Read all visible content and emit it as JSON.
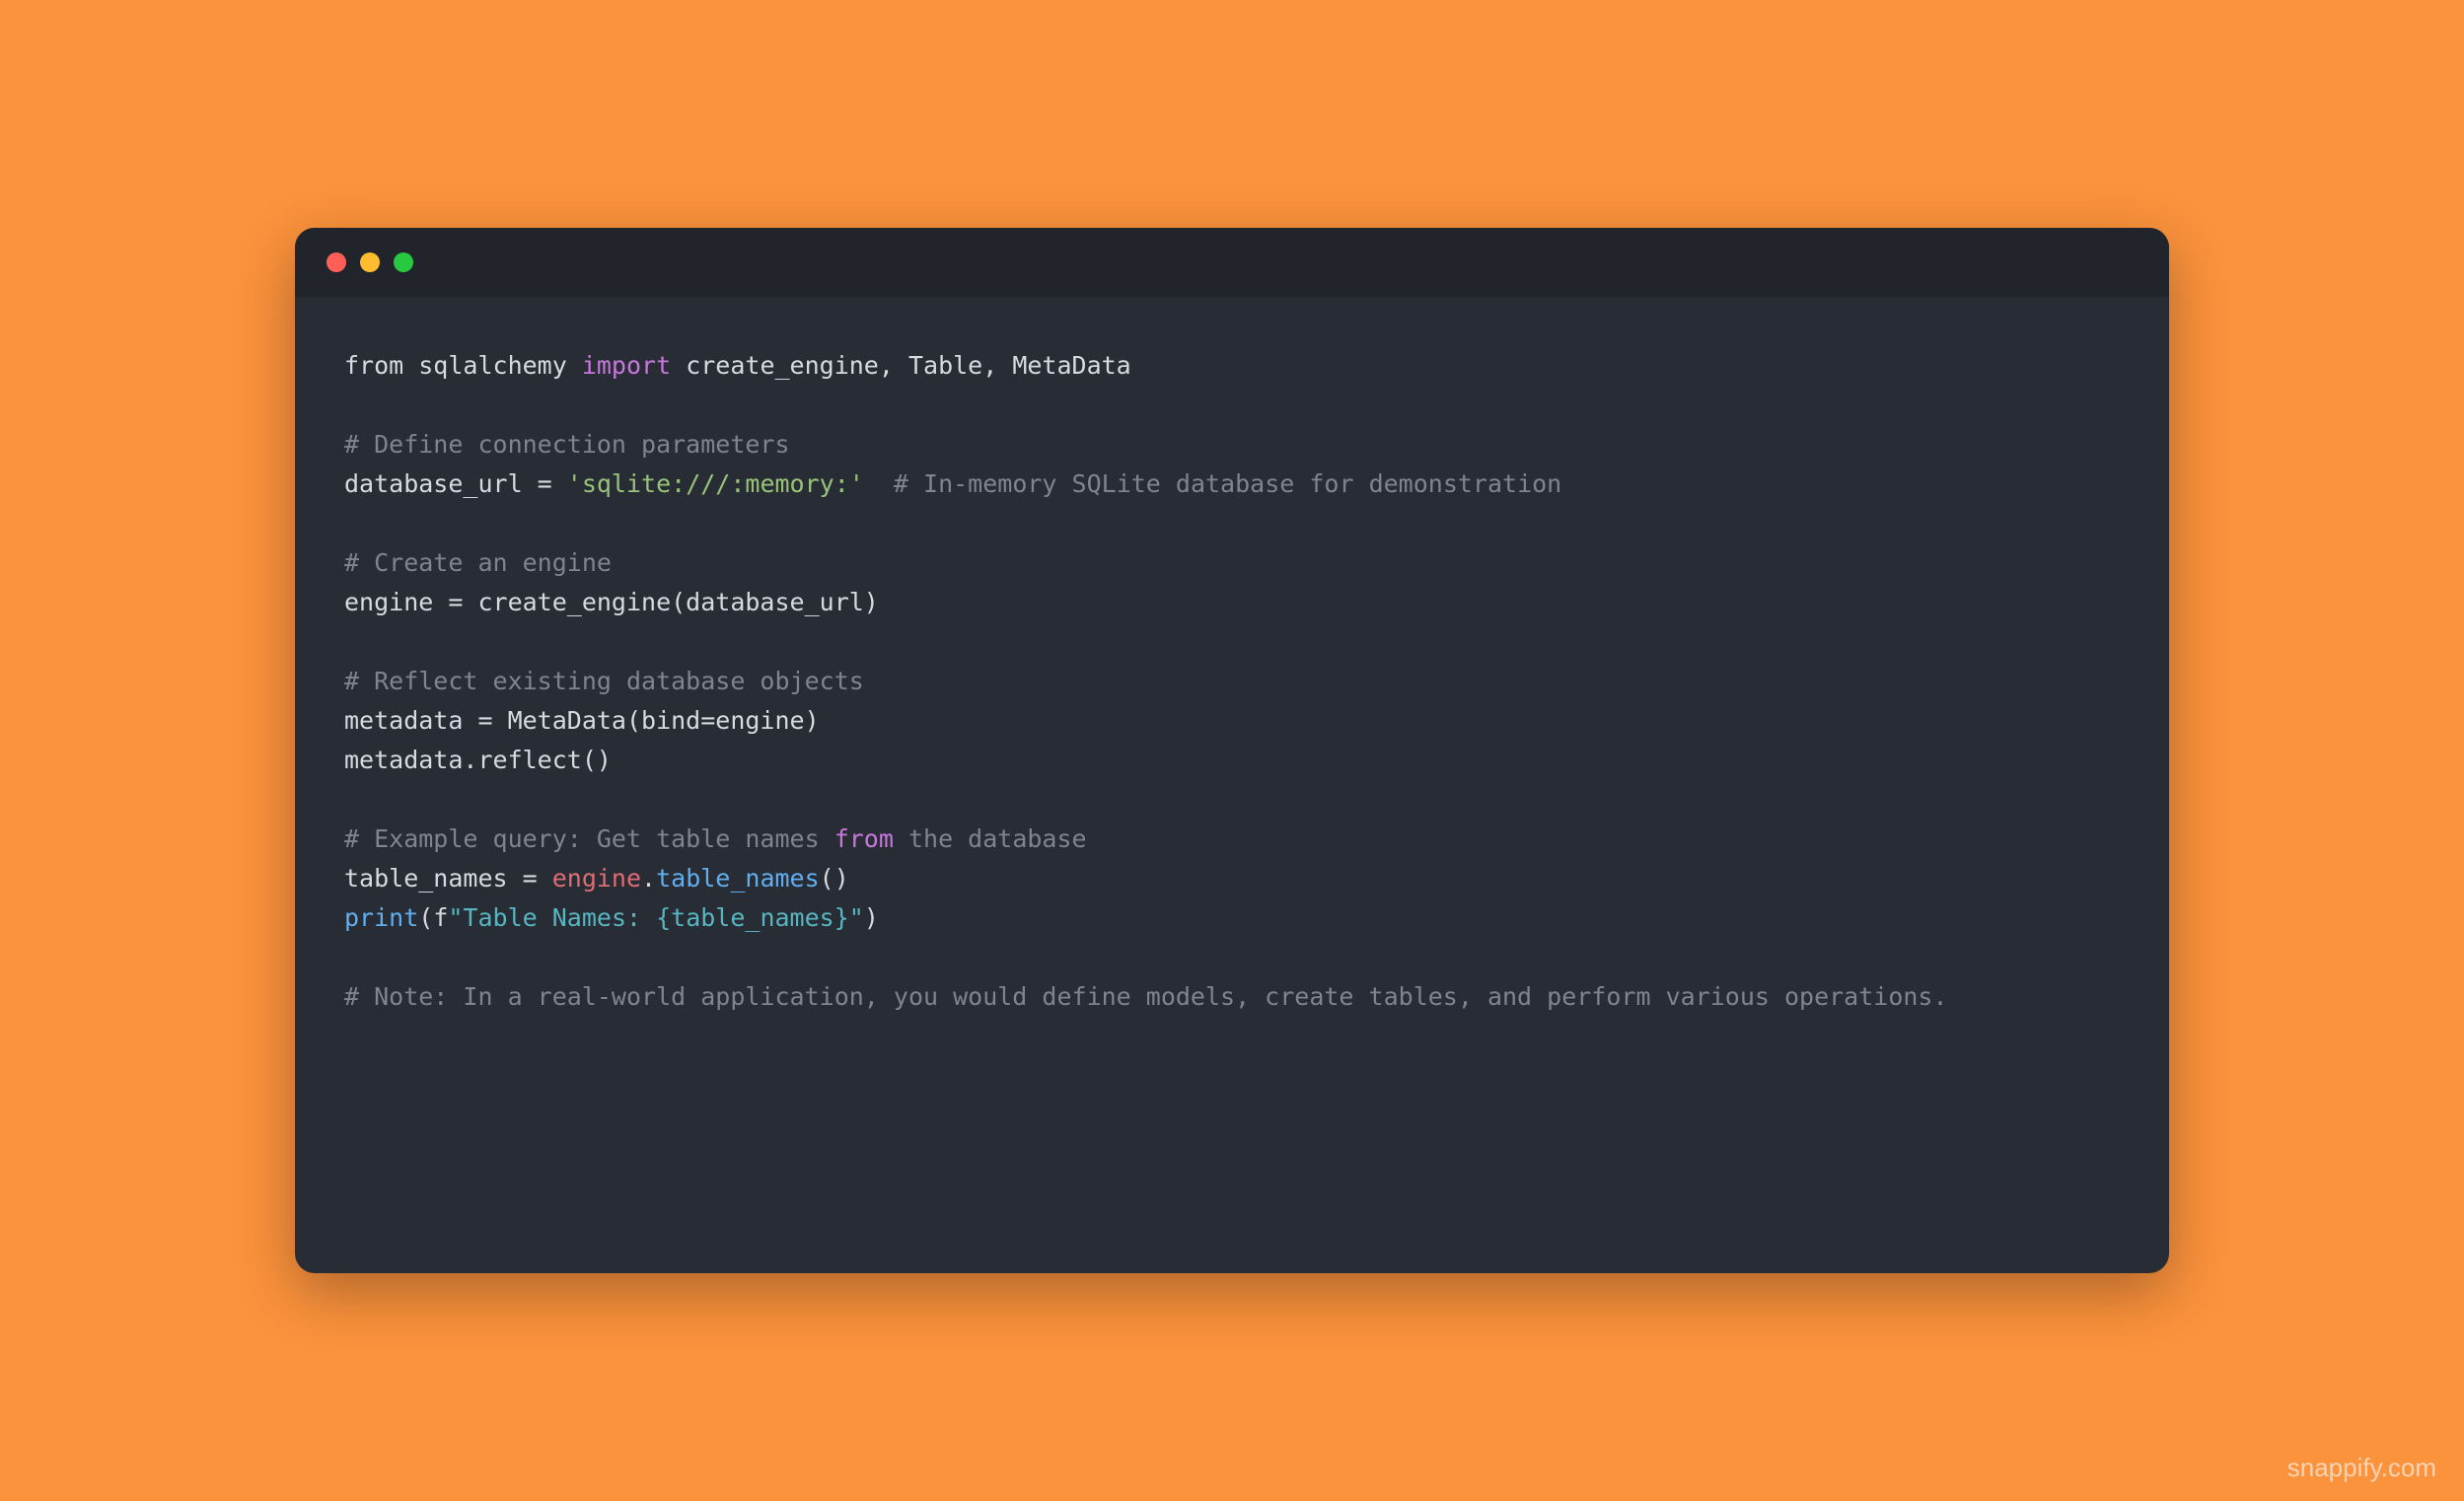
{
  "watermark": "snappify.com",
  "code": {
    "lines": [
      [
        {
          "cls": "tok-default",
          "text": "from sqlalchemy "
        },
        {
          "cls": "tok-keyword",
          "text": "import"
        },
        {
          "cls": "tok-default",
          "text": " create_engine, Table, MetaData"
        }
      ],
      [],
      [
        {
          "cls": "tok-comment",
          "text": "# Define connection parameters"
        }
      ],
      [
        {
          "cls": "tok-default",
          "text": "database_url = "
        },
        {
          "cls": "tok-string",
          "text": "'sqlite:///:memory:'"
        },
        {
          "cls": "tok-default",
          "text": "  "
        },
        {
          "cls": "tok-comment",
          "text": "# In-memory SQLite database for demonstration"
        }
      ],
      [],
      [
        {
          "cls": "tok-comment",
          "text": "# Create an engine"
        }
      ],
      [
        {
          "cls": "tok-default",
          "text": "engine = create_engine(database_url)"
        }
      ],
      [],
      [
        {
          "cls": "tok-comment",
          "text": "# Reflect existing database objects"
        }
      ],
      [
        {
          "cls": "tok-default",
          "text": "metadata = MetaData(bind=engine)"
        }
      ],
      [
        {
          "cls": "tok-default",
          "text": "metadata.reflect()"
        }
      ],
      [],
      [
        {
          "cls": "tok-comment",
          "text": "# Example query: Get table names "
        },
        {
          "cls": "tok-keyword",
          "text": "from"
        },
        {
          "cls": "tok-comment",
          "text": " the database"
        }
      ],
      [
        {
          "cls": "tok-default",
          "text": "table_names = "
        },
        {
          "cls": "tok-attr",
          "text": "engine"
        },
        {
          "cls": "tok-default",
          "text": "."
        },
        {
          "cls": "tok-func",
          "text": "table_names"
        },
        {
          "cls": "tok-default",
          "text": "()"
        }
      ],
      [
        {
          "cls": "tok-func",
          "text": "print"
        },
        {
          "cls": "tok-default",
          "text": "(f"
        },
        {
          "cls": "tok-fstring",
          "text": "\"Table Names: {table_names}\""
        },
        {
          "cls": "tok-default",
          "text": ")"
        }
      ],
      [],
      [
        {
          "cls": "tok-comment",
          "text": "# Note: In a real-world application, you would define models, create tables, and perform various operations."
        }
      ]
    ]
  }
}
